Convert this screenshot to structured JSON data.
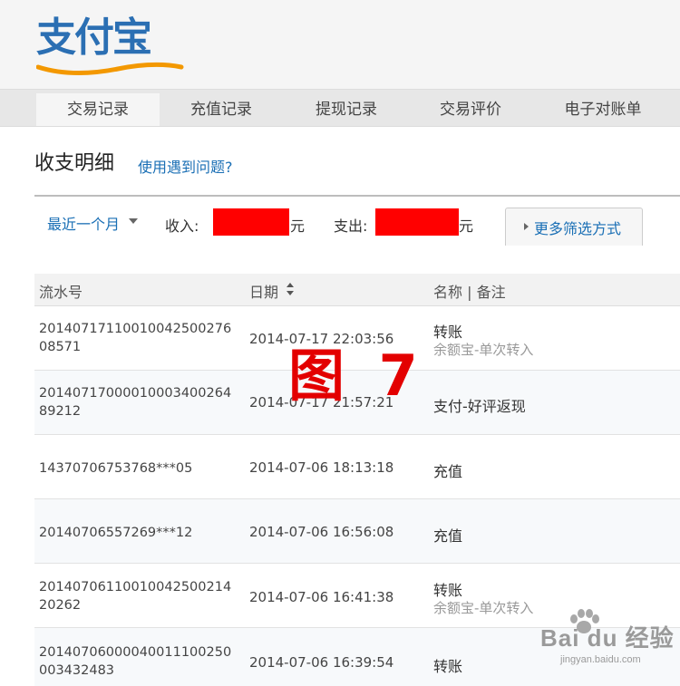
{
  "header": {
    "logo_text": "支付宝"
  },
  "nav": {
    "tabs": [
      {
        "label": "交易记录",
        "active": true
      },
      {
        "label": "充值记录",
        "active": false
      },
      {
        "label": "提现记录",
        "active": false
      },
      {
        "label": "交易评价",
        "active": false
      },
      {
        "label": "电子对账单",
        "active": false
      }
    ]
  },
  "page": {
    "title": "收支明细",
    "help_link": "使用遇到问题?"
  },
  "filter": {
    "period": "最近一个月",
    "income_label": "收入:",
    "income_unit": "元",
    "expense_label": "支出:",
    "expense_unit": "元",
    "more_filters": "更多筛选方式",
    "redaction_color": "#ff0000"
  },
  "table": {
    "headers": {
      "serial": "流水号",
      "date": "日期",
      "name": "名称 | 备注"
    },
    "rows": [
      {
        "serial": "20140717110010042500276 08571",
        "date": "2014-07-17 22:03:56",
        "name": "转账",
        "note": "余额宝-单次转入"
      },
      {
        "serial": "20140717000010003400264 89212",
        "date": "2014-07-17 21:57:21",
        "name": "支付-好评返现",
        "note": ""
      },
      {
        "serial": "14370706753768***05",
        "date": "2014-07-06 18:13:18",
        "name": "充值",
        "note": ""
      },
      {
        "serial": "20140706557269***12",
        "date": "2014-07-06 16:56:08",
        "name": "充值",
        "note": ""
      },
      {
        "serial": "20140706110010042500214 20262",
        "date": "2014-07-06 16:41:38",
        "name": "转账",
        "note": "余额宝-单次转入"
      },
      {
        "serial": "20140706000040011100250 003432483",
        "date": "2014-07-06 16:39:54",
        "name": "转账",
        "note": ""
      }
    ]
  },
  "overlay": {
    "stamp": "图 7"
  },
  "watermark": {
    "brand": "Bai du 经验",
    "site": "jingyan.baidu.com"
  },
  "colors": {
    "link": "#1a6fb5",
    "logo": "#2b6fb3",
    "stamp": "#e30000"
  }
}
